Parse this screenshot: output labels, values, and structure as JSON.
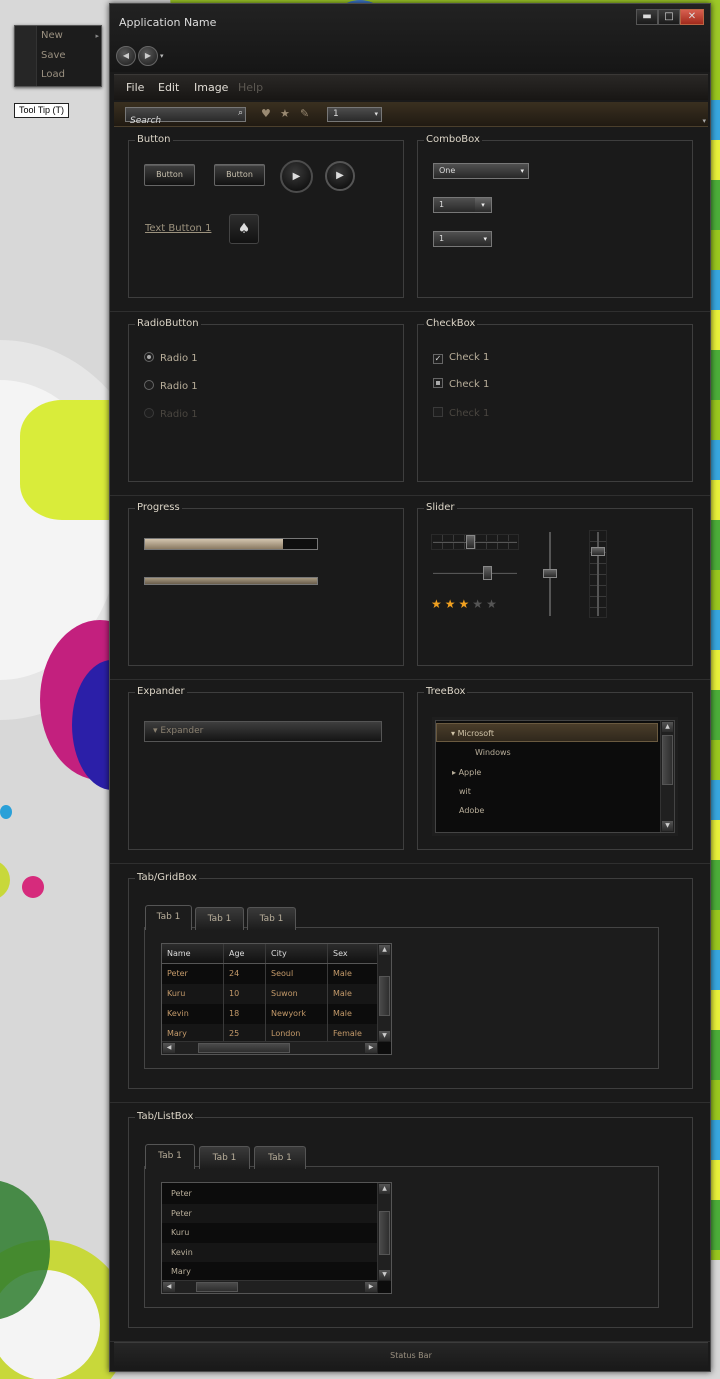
{
  "context_menu": {
    "items": [
      {
        "label": "New",
        "has_submenu": true
      },
      {
        "label": "Save"
      },
      {
        "label": "Load"
      }
    ],
    "submenu_glyph": "▸"
  },
  "tooltip": {
    "text": "Tool Tip (T)"
  },
  "window": {
    "title": "Application Name",
    "controls": {
      "minimize": "▬",
      "maximize": "□",
      "close": "✕"
    },
    "nav": {
      "back": "◀",
      "forward": "▶",
      "history": "▾"
    }
  },
  "menubar": {
    "items": [
      {
        "label": "File",
        "enabled": true
      },
      {
        "label": "Edit",
        "enabled": true
      },
      {
        "label": "Image",
        "enabled": true
      },
      {
        "label": "Help",
        "enabled": false
      }
    ]
  },
  "toolbar": {
    "search_placeholder": "Search",
    "search_glyph": "⌕",
    "icons": [
      {
        "name": "heart-icon",
        "glyph": "♥"
      },
      {
        "name": "star-icon",
        "glyph": "★"
      },
      {
        "name": "leaf-icon",
        "glyph": "✎"
      }
    ],
    "combo_value": "1",
    "dropdown_glyph": "▾",
    "overflow_glyph": "▾"
  },
  "button_group": {
    "title": "Button",
    "buttons": [
      "Button",
      "Button"
    ],
    "play_glyph": "▶",
    "text_button": "Text Button 1",
    "icon_button_glyph": "♠"
  },
  "combobox_group": {
    "title": "ComboBox",
    "combos": [
      "One",
      "1",
      "1"
    ],
    "arrow_glyph": "▾"
  },
  "radio_group": {
    "title": "RadioButton",
    "items": [
      {
        "label": "Radio 1",
        "checked": true,
        "enabled": true
      },
      {
        "label": "Radio 1",
        "checked": false,
        "enabled": true
      },
      {
        "label": "Radio 1",
        "checked": false,
        "enabled": false
      }
    ]
  },
  "checkbox_group": {
    "title": "CheckBox",
    "items": [
      {
        "label": "Check 1",
        "state": "checked",
        "enabled": true
      },
      {
        "label": "Check 1",
        "state": "indeterminate",
        "enabled": true
      },
      {
        "label": "Check 1",
        "state": "unchecked",
        "enabled": false
      }
    ],
    "check_glyph": "✓"
  },
  "progress_group": {
    "title": "Progress",
    "bars": [
      {
        "value_percent": 80
      },
      {
        "value_percent": 100
      }
    ]
  },
  "slider_group": {
    "title": "Slider",
    "horizontal": [
      {
        "value_percent": 45,
        "ticks": true
      },
      {
        "value_percent": 65,
        "ticks": false
      }
    ],
    "vertical": [
      {
        "value_percent": 50,
        "ticks": false
      },
      {
        "value_percent": 75,
        "ticks": true
      }
    ],
    "rating": {
      "value": 3,
      "max": 5,
      "glyph": "★"
    }
  },
  "expander_group": {
    "title": "Expander",
    "expander_label": "Expander",
    "expander_glyph": "▾"
  },
  "treebox_group": {
    "title": "TreeBox",
    "items": [
      {
        "label": "Microsoft",
        "level": 0,
        "expanded": true,
        "selected": true,
        "glyph": "▾"
      },
      {
        "label": "Windows",
        "level": 1,
        "selected": false
      },
      {
        "label": "Apple",
        "level": 0,
        "expanded": false,
        "selected": false,
        "glyph": "▸"
      },
      {
        "label": "wit",
        "level": 0,
        "selected": false
      },
      {
        "label": "Adobe",
        "level": 0,
        "selected": false
      }
    ]
  },
  "tab_grid_group": {
    "title": "Tab/GridBox",
    "tabs": [
      "Tab 1",
      "Tab 1",
      "Tab 1"
    ],
    "columns": [
      "Name",
      "Age",
      "City",
      "Sex"
    ],
    "rows": [
      [
        "Peter",
        "24",
        "Seoul",
        "Male"
      ],
      [
        "Kuru",
        "10",
        "Suwon",
        "Male"
      ],
      [
        "Kevin",
        "18",
        "Newyork",
        "Male"
      ],
      [
        "Mary",
        "25",
        "London",
        "Female"
      ]
    ]
  },
  "tab_list_group": {
    "title": "Tab/ListBox",
    "tabs": [
      "Tab 1",
      "Tab 1",
      "Tab 1"
    ],
    "items": [
      "Peter",
      "Peter",
      "Kuru",
      "Kevin",
      "Mary"
    ]
  },
  "scroll_glyphs": {
    "up": "▲",
    "down": "▼",
    "left": "◀",
    "right": "▶"
  },
  "statusbar": {
    "text": "Status Bar"
  },
  "colors": {
    "window_bg": "#1a1a1a",
    "accent_gold": "#c49a6a",
    "star_on": "#f0a020",
    "close_red": "#c0392b"
  }
}
